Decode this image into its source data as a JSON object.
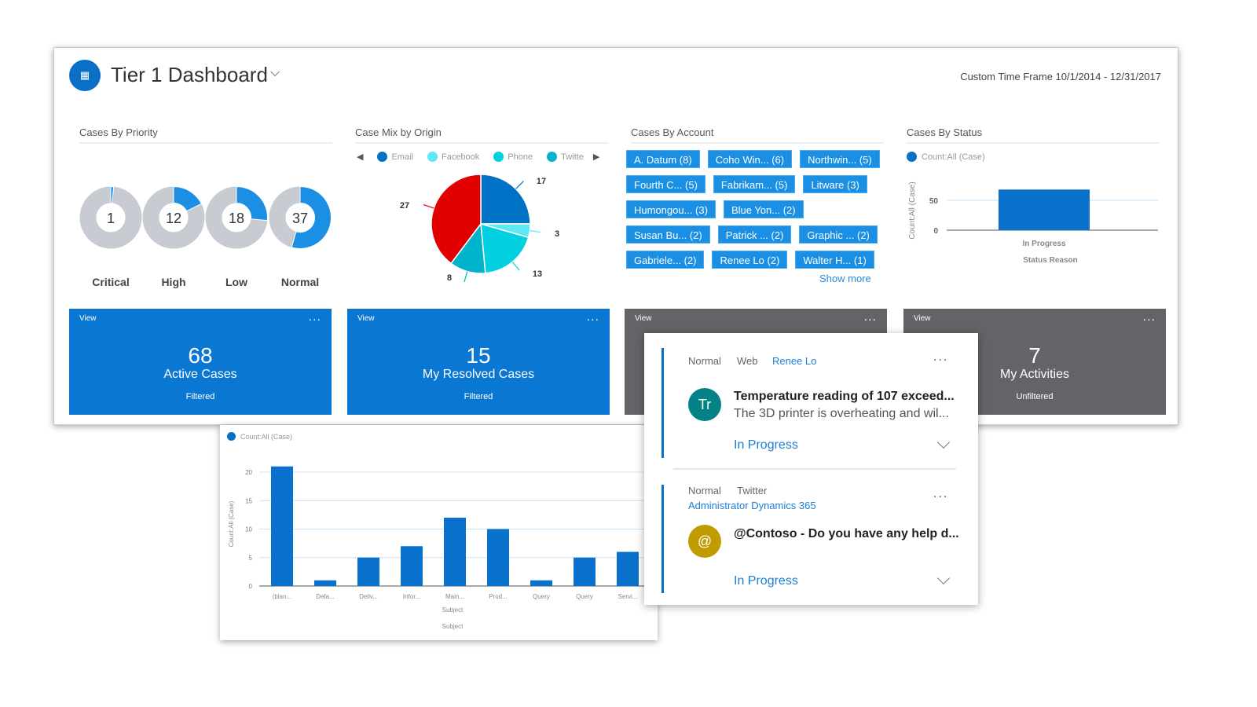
{
  "header": {
    "title": "Tier 1 Dashboard",
    "icon": "dashboard-icon",
    "time_frame": "Custom Time Frame 10/1/2014 - 12/31/2017"
  },
  "colors": {
    "accent": "#0a78d2",
    "tile_gray": "#626467",
    "donut_bg": "#c8ccd2",
    "donut_fill": "#1a8fe3"
  },
  "priority": {
    "title": "Cases By Priority",
    "total": 68,
    "items": [
      {
        "label": "Critical",
        "value": 1
      },
      {
        "label": "High",
        "value": 12
      },
      {
        "label": "Low",
        "value": 18
      },
      {
        "label": "Normal",
        "value": 37
      }
    ]
  },
  "origin": {
    "title": "Case Mix by Origin",
    "legend": [
      {
        "name": "Email",
        "color": "#0072c6"
      },
      {
        "name": "Facebook",
        "color": "#5ee8f5"
      },
      {
        "name": "Phone",
        "color": "#00d0e0"
      },
      {
        "name": "Twitte",
        "color": "#00b4cc"
      }
    ]
  },
  "accounts": {
    "title": "Cases By Account",
    "rows": [
      [
        "A. Datum (8)",
        "Coho Win... (6)",
        "Northwin... (5)"
      ],
      [
        "Fourth C... (5)",
        "Fabrikam... (5)",
        "Litware (3)"
      ],
      [
        "Humongou... (3)",
        "Blue Yon... (2)"
      ],
      [
        "Susan Bu... (2)",
        "Patrick ... (2)",
        "Graphic ... (2)"
      ],
      [
        "Gabriele... (2)",
        "Renee Lo (2)",
        "Walter H... (1)"
      ]
    ],
    "show_more": "Show more"
  },
  "status": {
    "title": "Cases By Status",
    "legend": "Count:All (Case)"
  },
  "tiles": [
    {
      "view": "View",
      "more": "...",
      "number": "68",
      "name": "Active Cases",
      "filter": "Filtered"
    },
    {
      "view": "View",
      "more": "...",
      "number": "15",
      "name": "My Resolved Cases",
      "filter": "Filtered"
    },
    {
      "view": "View",
      "more": "..."
    },
    {
      "view": "View",
      "more": "...",
      "number": "7",
      "name": "My Activities",
      "filter": "Unfiltered"
    }
  ],
  "activities": [
    {
      "priority": "Normal",
      "channel": "Web",
      "owner": "Renee Lo",
      "initials": "Tr",
      "avatar_color": "#038387",
      "title": "Temperature reading of 107 exceed...",
      "description": "The 3D printer is overheating and wil...",
      "status": "In Progress",
      "more": "..."
    },
    {
      "priority": "Normal",
      "channel": "Twitter",
      "owner": "Administrator Dynamics 365",
      "initials": "@",
      "avatar_color": "#c19c00",
      "title": "@Contoso - Do you have any help d...",
      "status": "In Progress",
      "more": "..."
    }
  ],
  "chart_data": [
    {
      "type": "pie",
      "title": "Case Mix by Origin",
      "categories": [
        "Email",
        "Facebook",
        "Phone",
        "Twitter",
        ""
      ],
      "values": [
        17,
        3,
        13,
        8,
        27
      ],
      "colors": [
        "#0072c6",
        "#5ee8f5",
        "#00d0e0",
        "#00b4cc",
        "#e00000"
      ]
    },
    {
      "type": "bar",
      "title": "Cases By Status",
      "legend": "Count:All (Case)",
      "categories": [
        "In Progress"
      ],
      "values": [
        68
      ],
      "xlabel": "Status Reason",
      "ylabel": "Count:All (Case)",
      "yticks": [
        0,
        50
      ],
      "ylim": [
        0,
        50
      ],
      "grid": true
    },
    {
      "type": "bar",
      "legend": "Count:All (Case)",
      "categories": [
        "(blan...",
        "Defa...",
        "Deliv...",
        "Infor...",
        "Main...",
        "Prod...",
        "Query",
        "Query",
        "Servi..."
      ],
      "values": [
        21,
        1,
        5,
        7,
        12,
        10,
        1,
        5,
        6
      ],
      "xlabel": "Subject",
      "xlabel2": "Subject",
      "ylabel": "Count:All (Case)",
      "yticks": [
        0,
        5,
        10,
        15,
        20
      ],
      "ylim": [
        0,
        20
      ],
      "grid": true
    }
  ]
}
